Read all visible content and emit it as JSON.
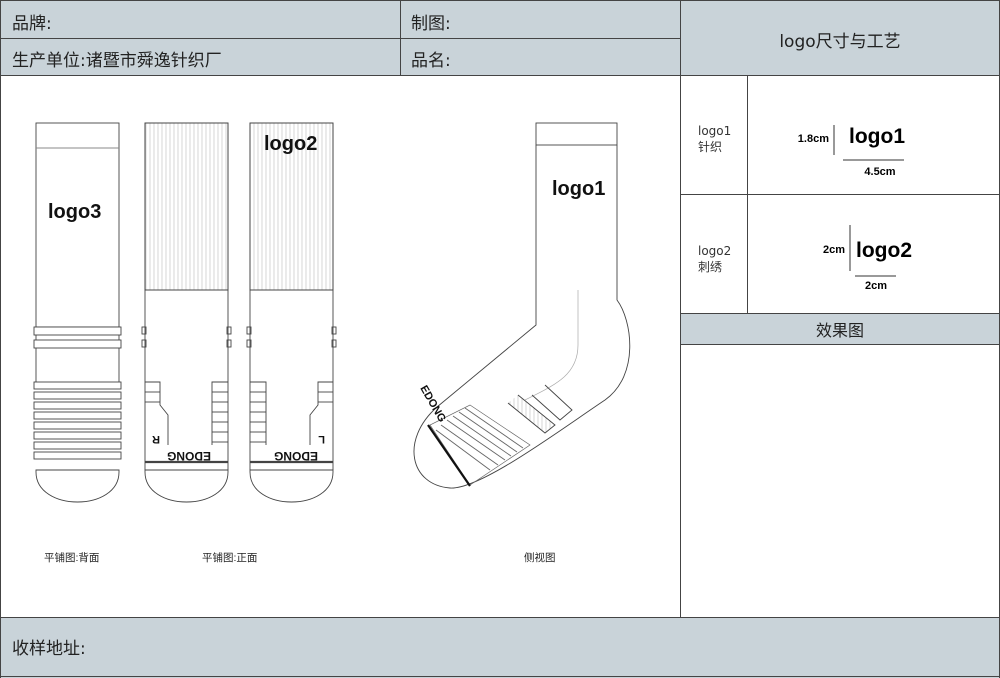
{
  "header": {
    "brand_label": "品牌:",
    "drawer_label": "制图:",
    "producer_label": "生产单位:诸暨市舜逸针织厂",
    "product_name_label": "品名:",
    "logo_spec_title": "logo尺寸与工艺"
  },
  "logo_specs": [
    {
      "name": "logo1",
      "process": "针织",
      "height": "1.8cm",
      "width": "4.5cm"
    },
    {
      "name": "logo2",
      "process": "刺绣",
      "height": "2cm",
      "width": "2cm"
    }
  ],
  "effect_title": "效果图",
  "footer": {
    "address_label": "收样地址:"
  },
  "drawings": {
    "back_logo": "logo3",
    "front_logo": "logo2",
    "side_logo": "logo1",
    "sole_text": "EDONG",
    "right_mark": "R",
    "left_mark": "L",
    "caption_back": "平铺图:背面",
    "caption_front": "平铺图:正面",
    "caption_side": "侧视图"
  },
  "colors": {
    "header_bg": "#c9d3d9",
    "border": "#444444"
  }
}
